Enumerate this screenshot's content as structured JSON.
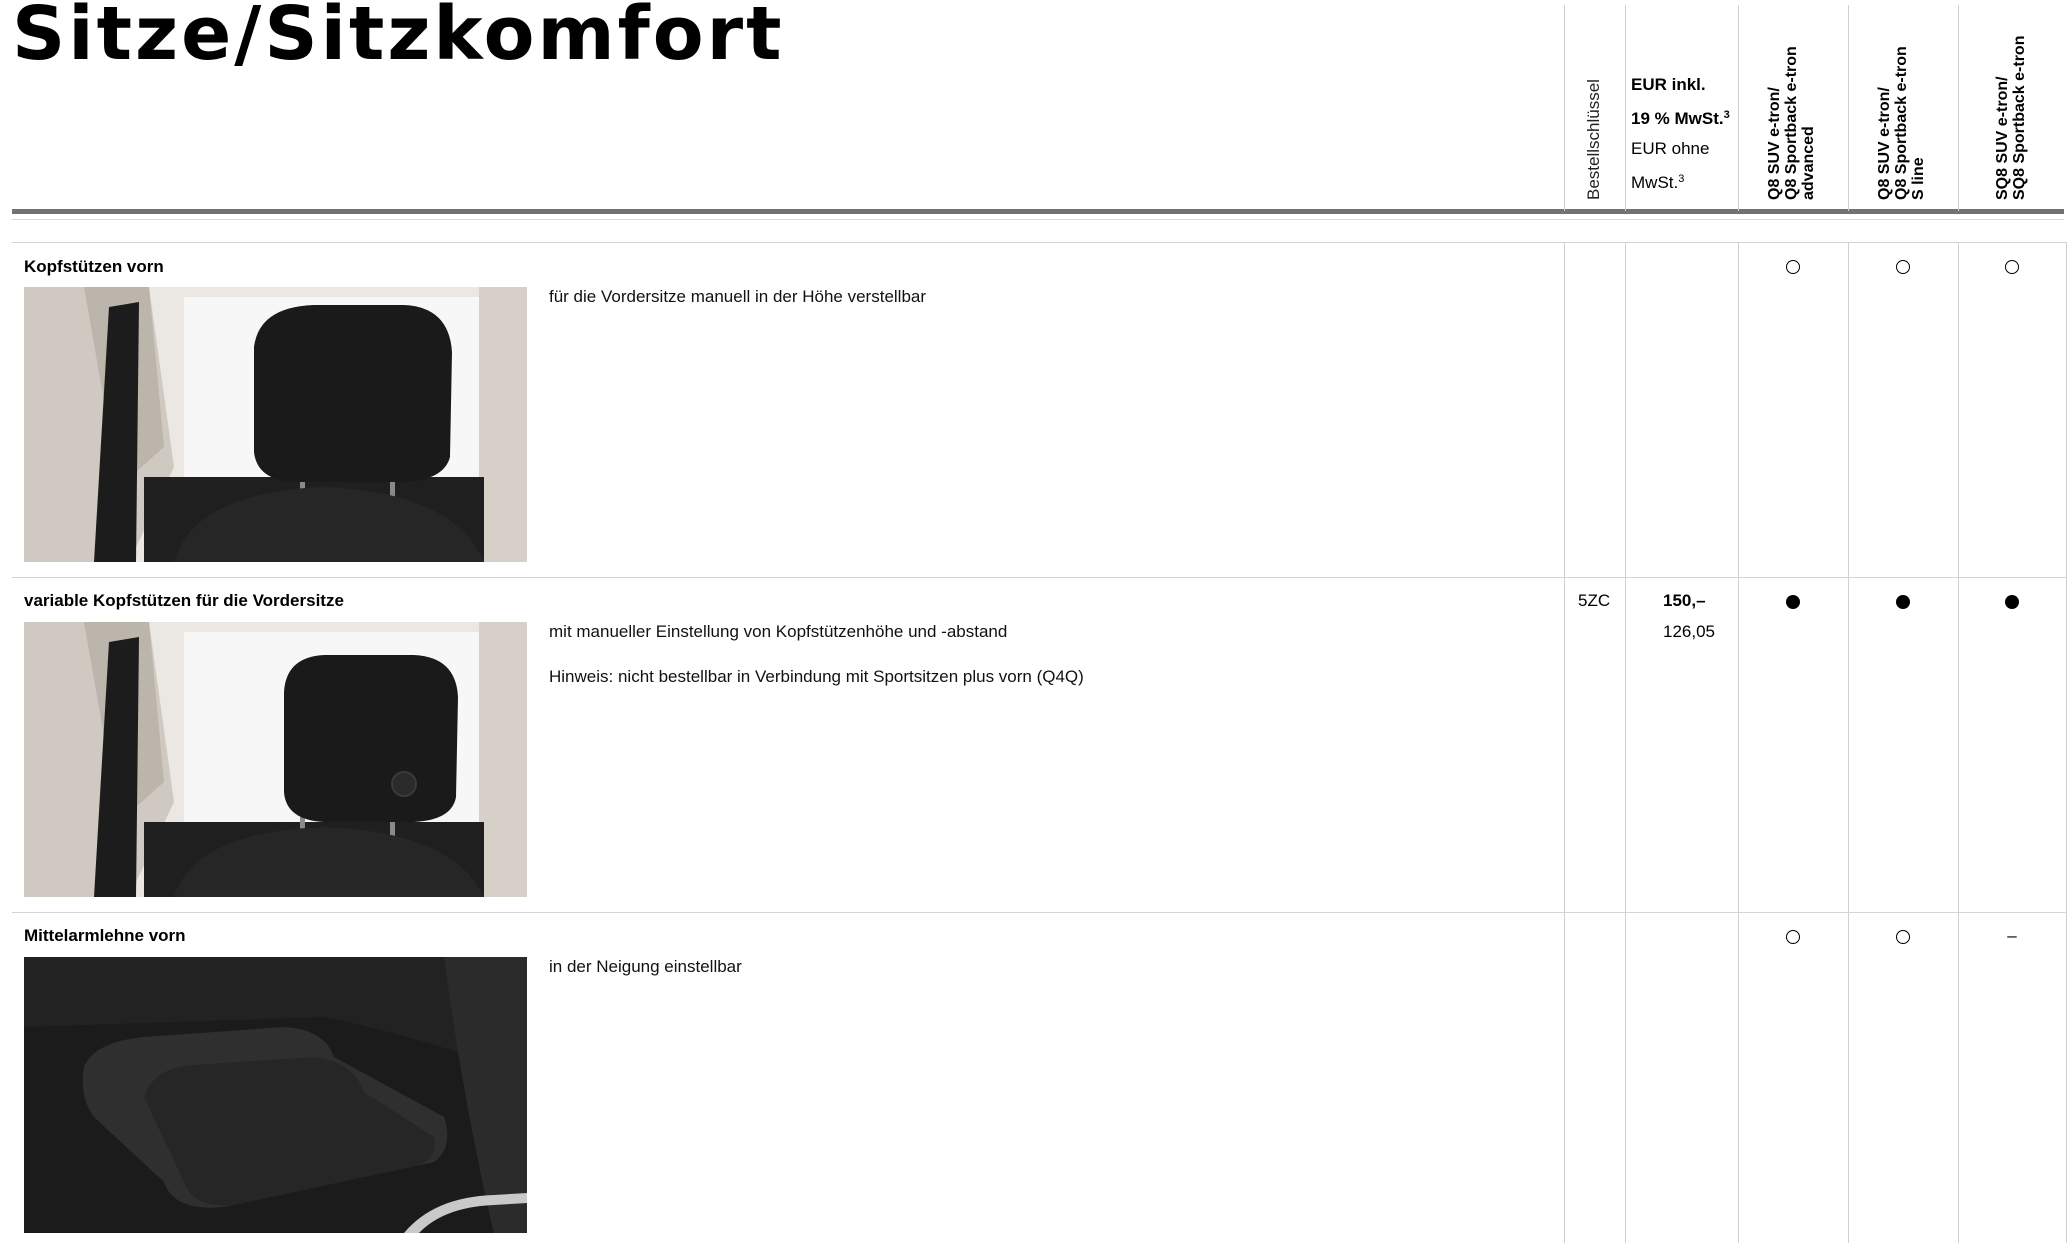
{
  "page": {
    "title": "Sitze/Sitzkomfort"
  },
  "headers": {
    "order_key": "Bestellschlüssel",
    "price_incl_line1": "EUR inkl.",
    "price_incl_line2": "19 % MwSt.",
    "price_excl_line1": "EUR ohne",
    "price_excl_line2": "MwSt.",
    "footnote": "3",
    "models": [
      "Q8 SUV e-tron/\nQ8 Sportback e-tron\nadvanced",
      "Q8 SUV e-tron/\nQ8 Sportback e-tron\nS line",
      "SQ8 SUV e-tron/\nSQ8 Sportback e-tron"
    ]
  },
  "rows": [
    {
      "title": "Kopfstützen vorn",
      "image_icon": "headrest-photo",
      "lines": [
        "für die Vordersitze manuell in der Höhe verstellbar"
      ],
      "code": "",
      "price_incl": "",
      "price_excl": "",
      "availability": [
        "optional",
        "optional",
        "optional"
      ]
    },
    {
      "title": "variable Kopfstützen für die Vordersitze",
      "image_icon": "variable-headrest-photo",
      "lines": [
        "mit manueller Einstellung von Kopfstützenhöhe und -abstand",
        "Hinweis: nicht bestellbar in Verbindung mit Sportsitzen plus vorn (Q4Q)"
      ],
      "code": "5ZC",
      "price_incl": "150,–",
      "price_excl": "126,05",
      "availability": [
        "standard",
        "standard",
        "standard"
      ]
    },
    {
      "title": "Mittelarmlehne vorn",
      "image_icon": "armrest-photo",
      "lines": [
        "in der Neigung einstellbar"
      ],
      "code": "",
      "price_incl": "",
      "price_excl": "",
      "availability": [
        "optional",
        "optional",
        "–"
      ]
    }
  ],
  "colors": {
    "rule": "#727272",
    "grid": "#cfcfcf",
    "text": "#000000"
  }
}
